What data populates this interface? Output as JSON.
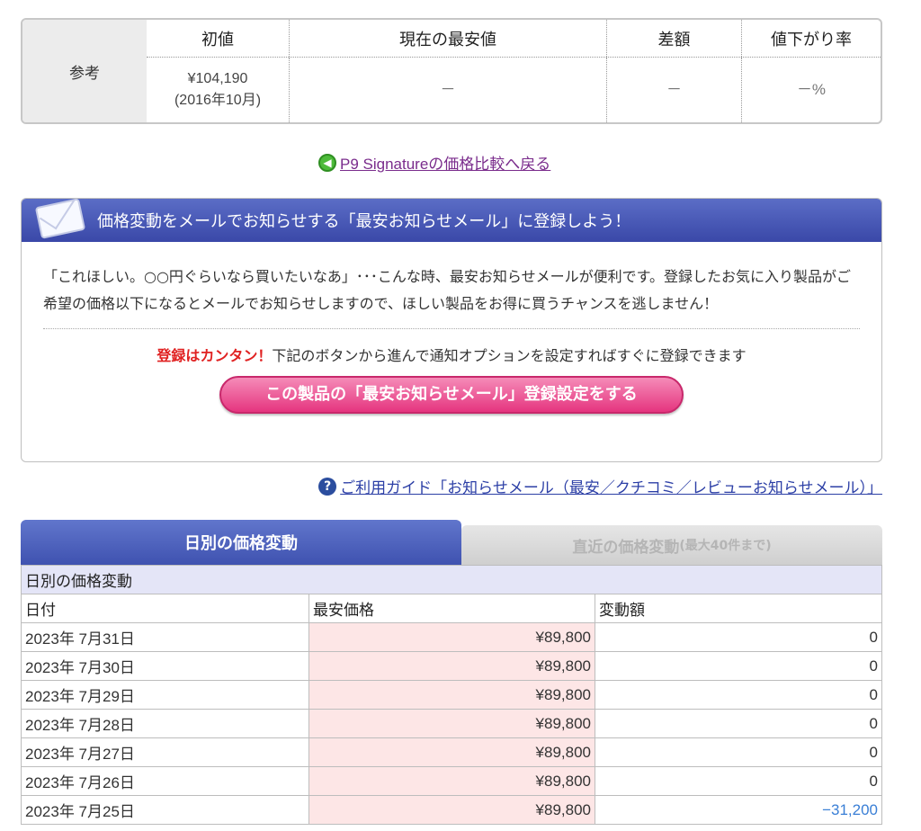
{
  "reference": {
    "label": "参考",
    "headers": [
      "初値",
      "現在の最安値",
      "差額",
      "値下がり率"
    ],
    "initial_price": "¥104,190",
    "initial_date": "(2016年10月)",
    "current_lowest": "－",
    "difference": "－",
    "drop_rate": "－%"
  },
  "back_link": {
    "icon": "green-back-arrow-icon",
    "text": "P9 Signatureの価格比較へ戻る"
  },
  "mail": {
    "header": "価格変動をメールでお知らせする「最安お知らせメール」に登録しよう！",
    "body": "「これほしい。○○円ぐらいなら買いたいなあ」･･･こんな時、最安お知らせメールが便利です。登録したお気に入り製品がご希望の価格以下になるとメールでお知らせしますので、ほしい製品をお得に買うチャンスを逃しません！",
    "cta_red": "登録はカンタン！",
    "cta_text": "下記のボタンから進んで通知オプションを設定すればすぐに登録できます",
    "button": "この製品の「最安お知らせメール」登録設定をする"
  },
  "guide_link": {
    "icon": "question-icon",
    "text": "ご利用ガイド「お知らせメール（最安／クチコミ／レビューお知らせメール）」"
  },
  "tabs": {
    "active": "日別の価格変動",
    "inactive": "直近の価格変動",
    "inactive_note": "(最大40件まで)"
  },
  "table": {
    "caption": "日別の価格変動",
    "headers": [
      "日付",
      "最安価格",
      "変動額"
    ],
    "rows": [
      {
        "date": "2023年 7月31日",
        "price": "¥89,800",
        "change": "0"
      },
      {
        "date": "2023年 7月30日",
        "price": "¥89,800",
        "change": "0"
      },
      {
        "date": "2023年 7月29日",
        "price": "¥89,800",
        "change": "0"
      },
      {
        "date": "2023年 7月28日",
        "price": "¥89,800",
        "change": "0"
      },
      {
        "date": "2023年 7月27日",
        "price": "¥89,800",
        "change": "0"
      },
      {
        "date": "2023年 7月26日",
        "price": "¥89,800",
        "change": "0"
      },
      {
        "date": "2023年 7月25日",
        "price": "¥89,800",
        "change": "−31,200"
      }
    ]
  },
  "colors": {
    "tab_active": "#4a5cbc",
    "mail_header": "#4556b4",
    "button_pink": "#e5357f",
    "price_cell_bg": "#fde6e6",
    "negative_change": "#3a7fd6",
    "cta_red": "#e02121"
  }
}
